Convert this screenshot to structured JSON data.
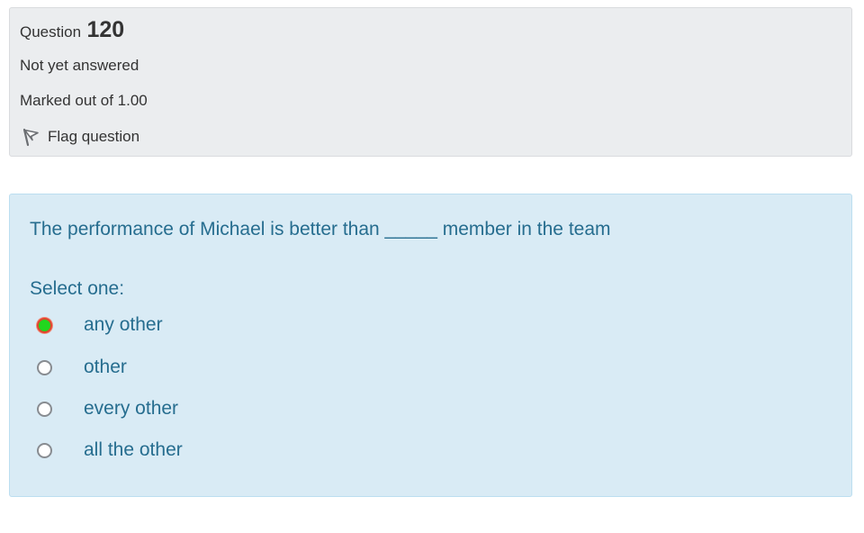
{
  "info": {
    "question_word": "Question",
    "question_number": "120",
    "state": "Not yet answered",
    "grade": "Marked out of 1.00",
    "flag_label": "Flag question"
  },
  "question": {
    "text": "The performance of Michael is better than _____ member in the team",
    "prompt": "Select one:",
    "options": [
      {
        "label": "any other",
        "selected": true
      },
      {
        "label": "other",
        "selected": false
      },
      {
        "label": "every other",
        "selected": false
      },
      {
        "label": "all the other",
        "selected": false
      }
    ]
  },
  "colors": {
    "info_bg": "#ebedef",
    "content_bg": "#d9ebf5",
    "content_text": "#266d8f",
    "selected_fill": "#21d61e",
    "selected_ring": "#e0452f"
  },
  "icons": {
    "flag": "flag-icon"
  }
}
